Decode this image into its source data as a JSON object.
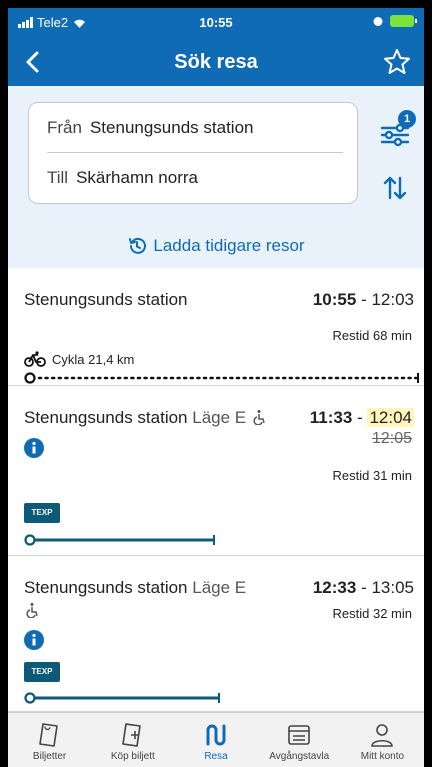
{
  "status_bar": {
    "carrier": "Tele2",
    "time": "10:55"
  },
  "header": {
    "title": "Sök resa"
  },
  "search": {
    "from_label": "Från",
    "from_value": "Stenungsunds station",
    "to_label": "Till",
    "to_value": "Skärhamn norra",
    "filter_badge": "1",
    "load_earlier": "Ladda tidigare resor"
  },
  "trips": [
    {
      "stop": "Stenungsunds station",
      "departure": "10:55",
      "separator": "-",
      "arrival": "12:03",
      "duration": "Restid 68 min",
      "mode": "Cykla 21,4 km"
    },
    {
      "stop": "Stenungsunds station",
      "position": "Läge E",
      "departure": "11:33",
      "separator": "-",
      "arrival": "12:04",
      "original_arrival": "12:05",
      "duration": "Restid 31 min",
      "line": "TEXP"
    },
    {
      "stop": "Stenungsunds station",
      "position": "Läge E",
      "departure": "12:33",
      "separator": "-",
      "arrival": "13:05",
      "duration": "Restid 32 min",
      "line": "TEXP"
    }
  ],
  "tabs": [
    {
      "label": "Biljetter",
      "icon": "ticket-icon"
    },
    {
      "label": "Köp biljett",
      "icon": "buy-ticket-icon"
    },
    {
      "label": "Resa",
      "icon": "route-icon",
      "active": true
    },
    {
      "label": "Avgångstavla",
      "icon": "departure-board-icon"
    },
    {
      "label": "Mitt konto",
      "icon": "account-icon"
    }
  ],
  "colors": {
    "brand": "#0f6cb4",
    "delay_highlight": "#fff6bd",
    "line_badge": "#0d5a78"
  }
}
